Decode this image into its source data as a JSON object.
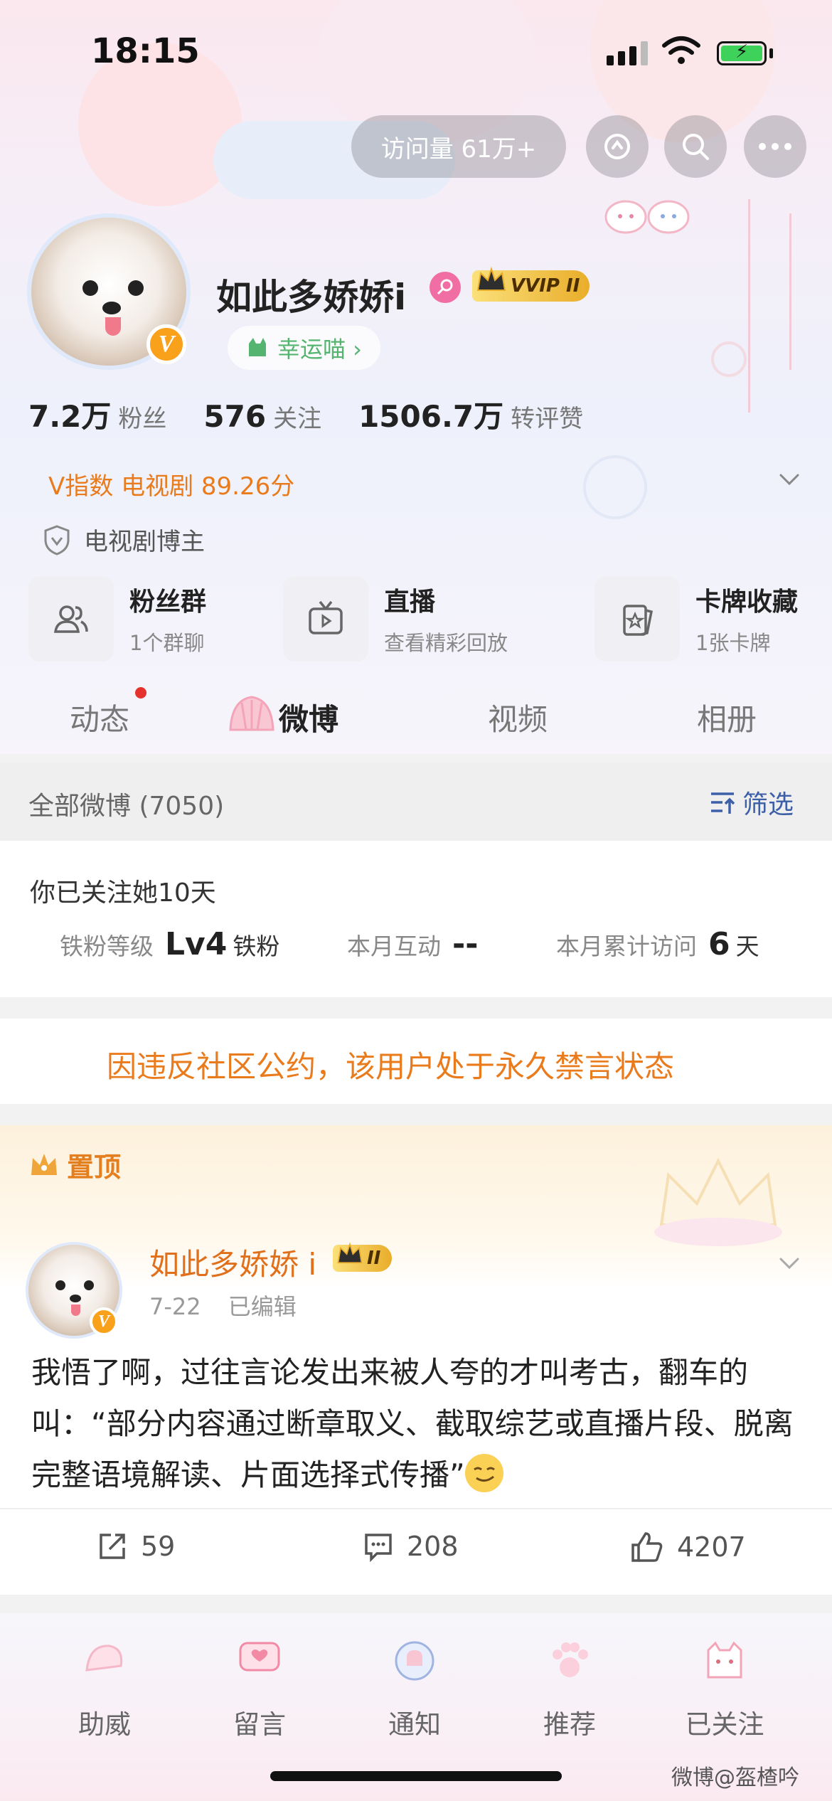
{
  "status_bar": {
    "time": "18:15"
  },
  "top_bar": {
    "visits_label": "访问量 61万+"
  },
  "profile": {
    "name": "如此多娇娇i",
    "vip_label": "VVIP",
    "vip_level": "II",
    "verified_letter": "V",
    "lucky_label": "幸运喵 ›",
    "stats": [
      {
        "num": "7.2万",
        "label": "粉丝"
      },
      {
        "num": "576",
        "label": "关注"
      },
      {
        "num": "1506.7万",
        "label": "转评赞"
      }
    ],
    "v_index": "V指数 电视剧 89.26分",
    "blogger_tag": "电视剧博主"
  },
  "quick_cards": [
    {
      "title": "粉丝群",
      "sub": "1个群聊"
    },
    {
      "title": "直播",
      "sub": "查看精彩回放"
    },
    {
      "title": "卡牌收藏",
      "sub": "1张卡牌"
    }
  ],
  "tabs": [
    {
      "label": "动态"
    },
    {
      "label": "微博"
    },
    {
      "label": "视频"
    },
    {
      "label": "相册"
    }
  ],
  "filter_bar": {
    "all_label": "全部微博 (7050)",
    "filter_label": "筛选"
  },
  "follow_card": {
    "title": "你已关注她10天",
    "fan_level_label": "铁粉等级",
    "fan_level_value": "Lv4",
    "fan_level_unit": "铁粉",
    "interaction_label": "本月互动",
    "interaction_value": "--",
    "visits_label": "本月累计访问",
    "visits_value": "6",
    "visits_unit": "天"
  },
  "ban_notice": "因违反社区公约，该用户处于永久禁言状态",
  "post": {
    "pinned_label": "置顶",
    "author": "如此多娇娇 i",
    "vip_level": "II",
    "date": "7-22",
    "edited": "已编辑",
    "text": "我悟了啊，过往言论发出来被人夸的才叫考古，翻车的叫：“部分内容通过断章取义、截取综艺或直播片段、脱离完整语境解读、片面选择式传播”",
    "reposts": "59",
    "comments": "208",
    "likes": "4207"
  },
  "bottom_bar": [
    {
      "label": "助威"
    },
    {
      "label": "留言"
    },
    {
      "label": "通知"
    },
    {
      "label": "推荐"
    },
    {
      "label": "已关注"
    }
  ],
  "watermark": "微博@盔楂吟",
  "colors": {
    "orange": "#ea7b1c",
    "link_blue": "#3c5fa8",
    "green": "#55b46f",
    "gold": "#f9a11b"
  }
}
